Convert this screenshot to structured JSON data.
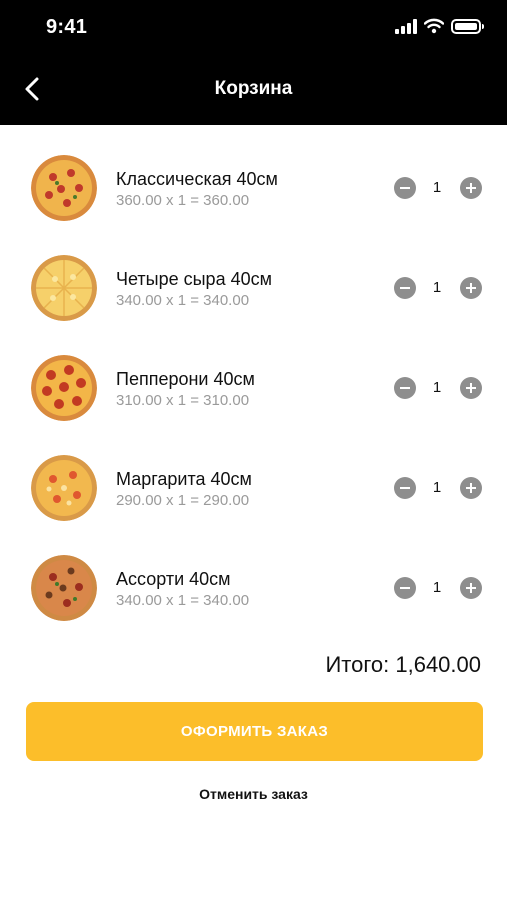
{
  "status_bar": {
    "time": "9:41",
    "icons": [
      "signal-icon",
      "wifi-icon",
      "battery-icon"
    ]
  },
  "header": {
    "back_icon": "chevron-left-icon",
    "title": "Корзина"
  },
  "cart": {
    "items": [
      {
        "name": "Классическая 40см",
        "calc": "360.00 x 1 = 360.00",
        "quantity": "1"
      },
      {
        "name": "Четыре сыра 40см",
        "calc": "340.00 x 1 = 340.00",
        "quantity": "1"
      },
      {
        "name": "Пепперони 40см",
        "calc": "310.00 x 1 = 310.00",
        "quantity": "1"
      },
      {
        "name": "Маргарита 40см",
        "calc": "290.00 x 1 = 290.00",
        "quantity": "1"
      },
      {
        "name": "Ассорти 40см",
        "calc": "340.00 x 1 = 340.00",
        "quantity": "1"
      }
    ],
    "total": "Итого: 1,640.00"
  },
  "actions": {
    "checkout_label": "ОФОРМИТЬ ЗАКАЗ",
    "cancel_label": "Отменить заказ"
  },
  "colors": {
    "header_bg": "#000000",
    "accent": "#fcbe2a",
    "muted_text": "#9a9a9a",
    "qty_button": "#8e8e8e"
  }
}
